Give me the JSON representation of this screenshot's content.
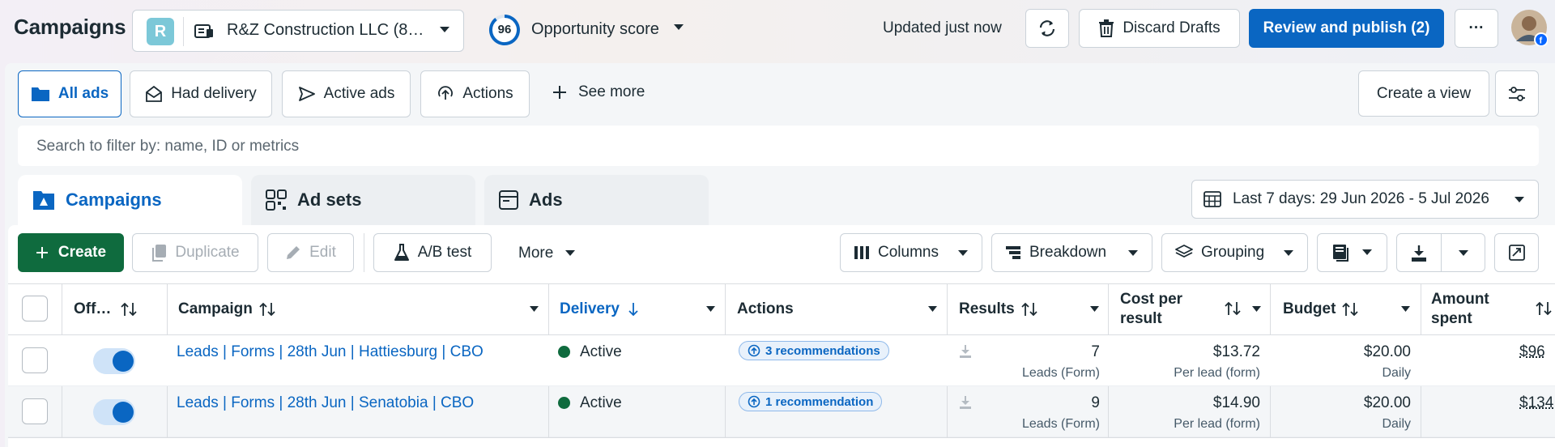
{
  "header": {
    "title": "Campaigns",
    "account": {
      "badge": "R",
      "name": "R&Z Construction LLC (8…"
    },
    "opportunity": {
      "score": "96",
      "label": "Opportunity score"
    },
    "updated": "Updated just now",
    "discard_label": "Discard Drafts",
    "publish_label": "Review and publish (2)",
    "more_label": "···"
  },
  "views": {
    "items": [
      "All ads",
      "Had delivery",
      "Active ads",
      "Actions"
    ],
    "see_more": "See more",
    "create_view": "Create a view"
  },
  "search": {
    "placeholder": "Search to filter by: name, ID or metrics"
  },
  "tabs": {
    "campaigns": "Campaigns",
    "adsets": "Ad sets",
    "ads": "Ads"
  },
  "date_range": "Last 7 days: 29 Jun 2026 - 5 Jul 2026",
  "toolbar": {
    "create": "Create",
    "duplicate": "Duplicate",
    "edit": "Edit",
    "ab_test": "A/B test",
    "more": "More",
    "columns": "Columns",
    "breakdown": "Breakdown",
    "grouping": "Grouping"
  },
  "table": {
    "headers": {
      "off_on": "Off…",
      "campaign": "Campaign",
      "delivery": "Delivery",
      "actions": "Actions",
      "results": "Results",
      "cost_line1": "Cost per",
      "cost_line2": "result",
      "budget": "Budget",
      "spent_line1": "Amount",
      "spent_line2": "spent"
    },
    "rows": [
      {
        "campaign": "Leads | Forms | 28th Jun | Hattiesburg | CBO",
        "delivery": "Active",
        "recommendation": "3 recommendations",
        "results": "7",
        "results_sub": "Leads (Form)",
        "cost": "$13.72",
        "cost_sub": "Per lead (form)",
        "budget": "$20.00",
        "budget_sub": "Daily",
        "spent": "$96"
      },
      {
        "campaign": "Leads | Forms | 28th Jun | Senatobia | CBO",
        "delivery": "Active",
        "recommendation": "1 recommendation",
        "results": "9",
        "results_sub": "Leads (Form)",
        "cost": "$14.90",
        "cost_sub": "Per lead (form)",
        "budget": "$20.00",
        "budget_sub": "Daily",
        "spent": "$134"
      }
    ]
  },
  "colors": {
    "primary_blue": "#0a66c2",
    "create_green": "#0f6b3e",
    "active_dot": "#0f6b3e"
  },
  "icons": [
    "briefcase-icon",
    "refresh-icon",
    "trash-icon",
    "more-icon",
    "folder-icon",
    "envelope-icon",
    "send-icon",
    "arrow-up-circle-icon",
    "plus-icon",
    "sliders-icon",
    "campaign-icon",
    "grid-icon",
    "ad-icon",
    "calendar-icon",
    "duplicate-icon",
    "pencil-icon",
    "flask-icon",
    "columns-icon",
    "breakdown-icon",
    "layers-icon",
    "reports-icon",
    "download-icon",
    "export-icon",
    "sort-icon"
  ]
}
